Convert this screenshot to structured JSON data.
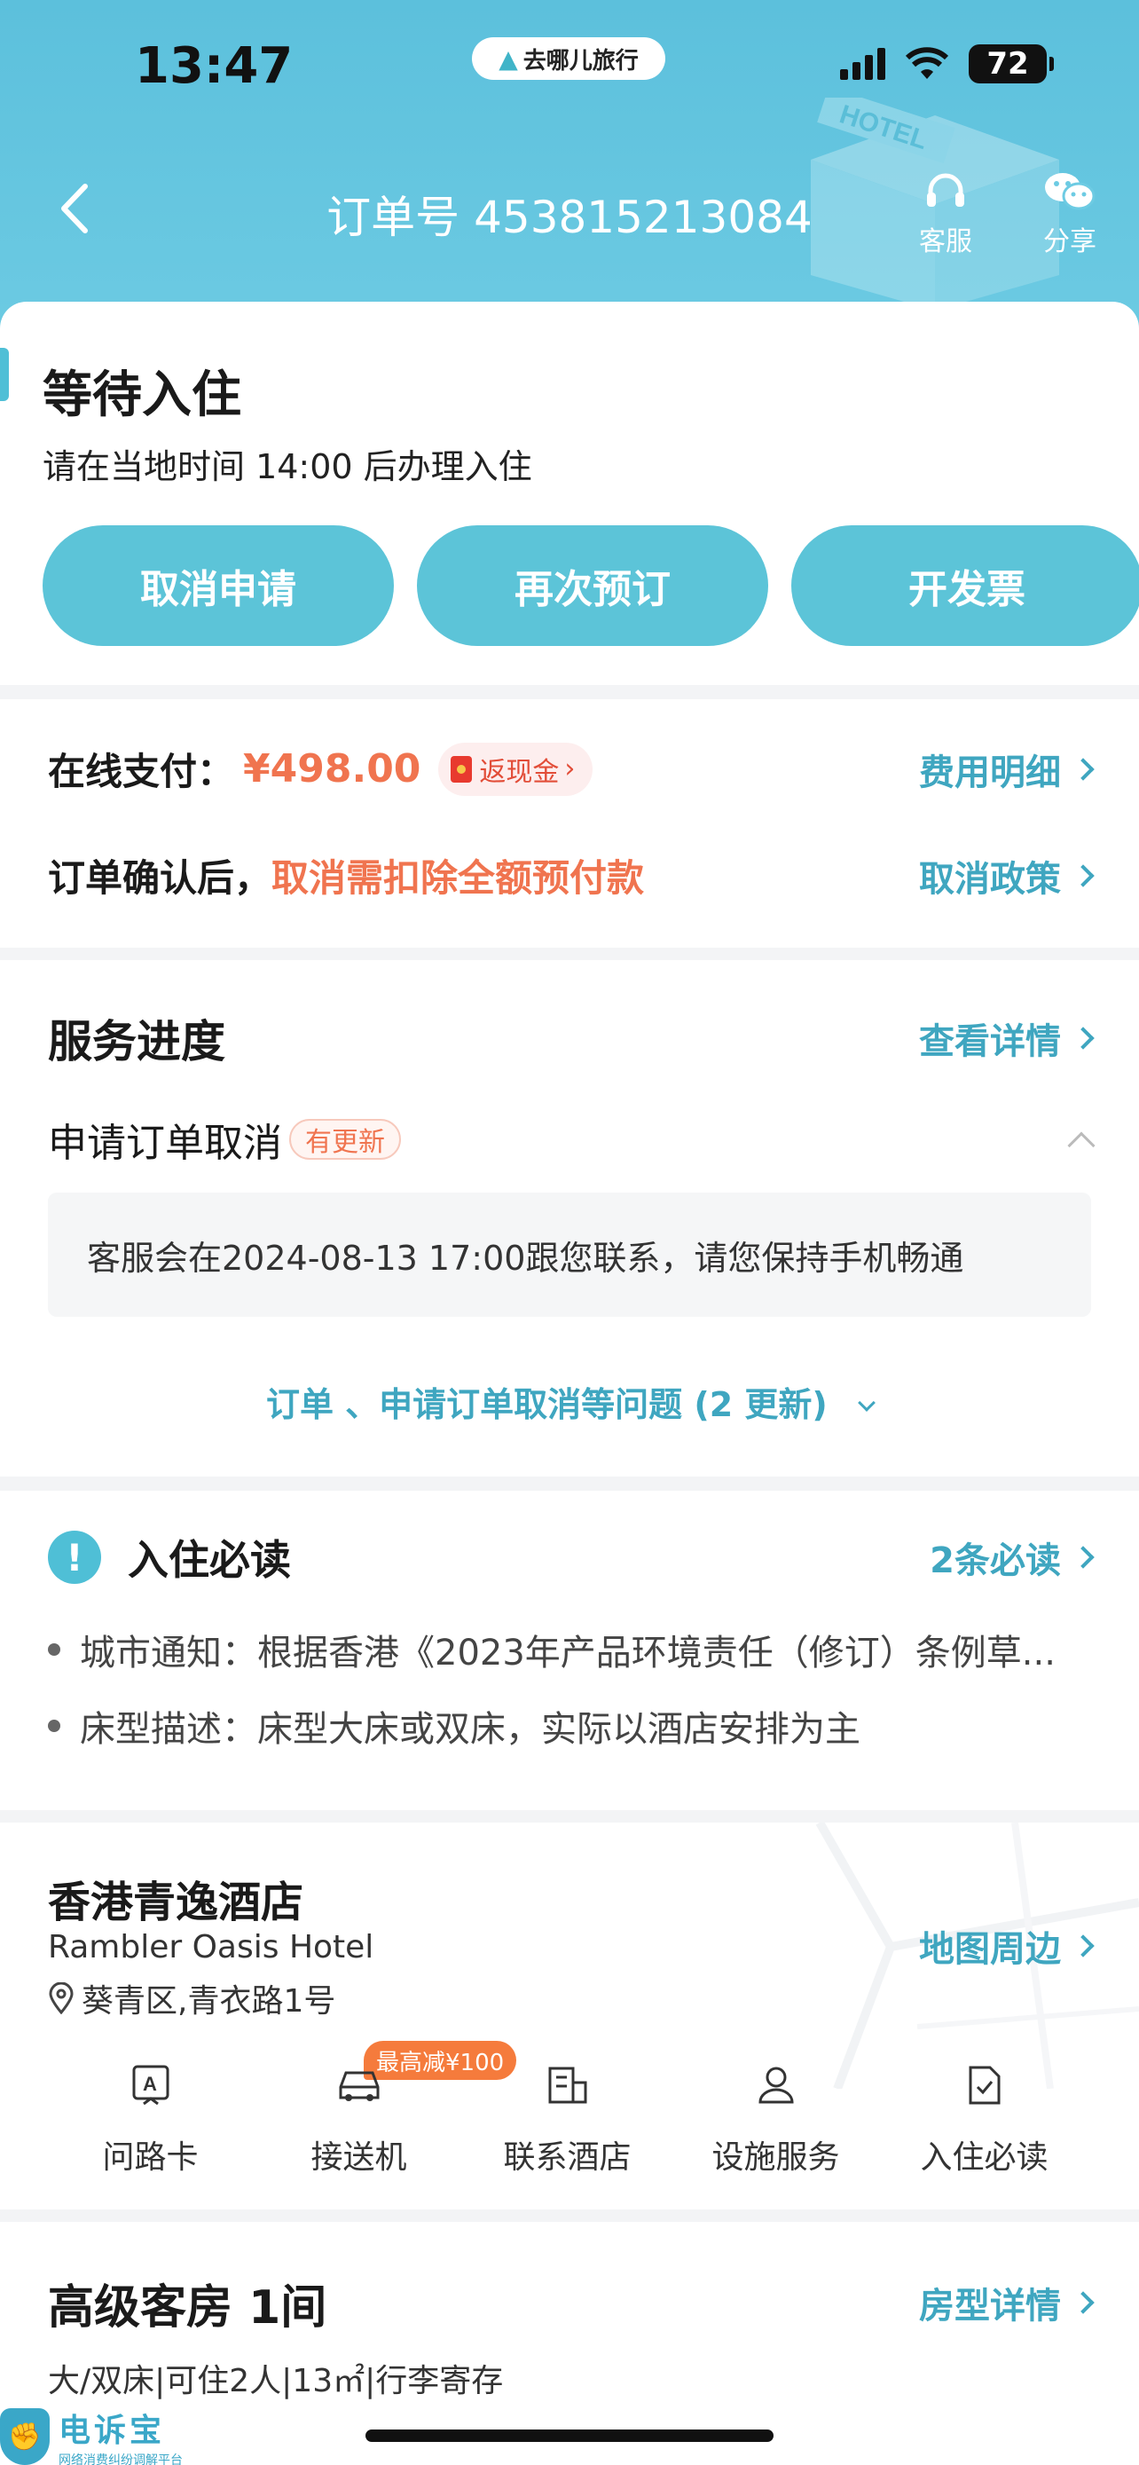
{
  "status_bar": {
    "time": "13:47",
    "app_pill": "去哪儿旅行",
    "battery": "72"
  },
  "nav": {
    "title": "订单号 453815213084",
    "service_label": "客服",
    "share_label": "分享",
    "deco_sign": "HOTEL"
  },
  "status": {
    "title": "等待入住",
    "subtitle": "请在当地时间 14:00 后办理入住",
    "buttons": [
      "取消申请",
      "再次预订",
      "开发票"
    ]
  },
  "payment": {
    "label": "在线支付：",
    "amount": "¥498.00",
    "cashback": "返现金",
    "fee_link": "费用明细",
    "cancel_note_prefix": "订单确认后，",
    "cancel_note_warning": "取消需扣除全额预付款",
    "policy_link": "取消政策"
  },
  "progress": {
    "title": "服务进度",
    "detail_link": "查看详情",
    "item_title": "申请订单取消",
    "item_tag": "有更新",
    "message": "客服会在2024-08-13 17:00跟您联系，请您保持手机畅通",
    "more_link": "订单 、申请订单取消等问题 (2 更新)"
  },
  "notice": {
    "title": "入住必读",
    "count_link": "2条必读",
    "items": [
      "城市通知：根据香港《2023年产品环境责任（修订）条例草...",
      "床型描述：床型大床或双床，实际以酒店安排为主"
    ]
  },
  "hotel": {
    "name": "香港青逸酒店",
    "name_en": "Rambler Oasis Hotel",
    "address": "葵青区,青衣路1号",
    "map_link": "地图周边",
    "promo": "最高减¥100",
    "quick_actions": [
      {
        "label": "问路卡",
        "icon": "direction-card-icon"
      },
      {
        "label": "接送机",
        "icon": "car-icon"
      },
      {
        "label": "联系酒店",
        "icon": "contact-hotel-icon"
      },
      {
        "label": "设施服务",
        "icon": "facility-icon"
      },
      {
        "label": "入住必读",
        "icon": "checkin-notice-icon"
      }
    ]
  },
  "room": {
    "title": "高级客房 1间",
    "detail_link": "房型详情",
    "meta": "大/双床|可住2人|13㎡|行李寄存"
  },
  "watermark": {
    "main": "电诉宝",
    "sub": "网络消费纠纷调解平台"
  },
  "colors": {
    "accent": "#5cc4d8",
    "link": "#3fa6c0",
    "price": "#f0744f"
  }
}
